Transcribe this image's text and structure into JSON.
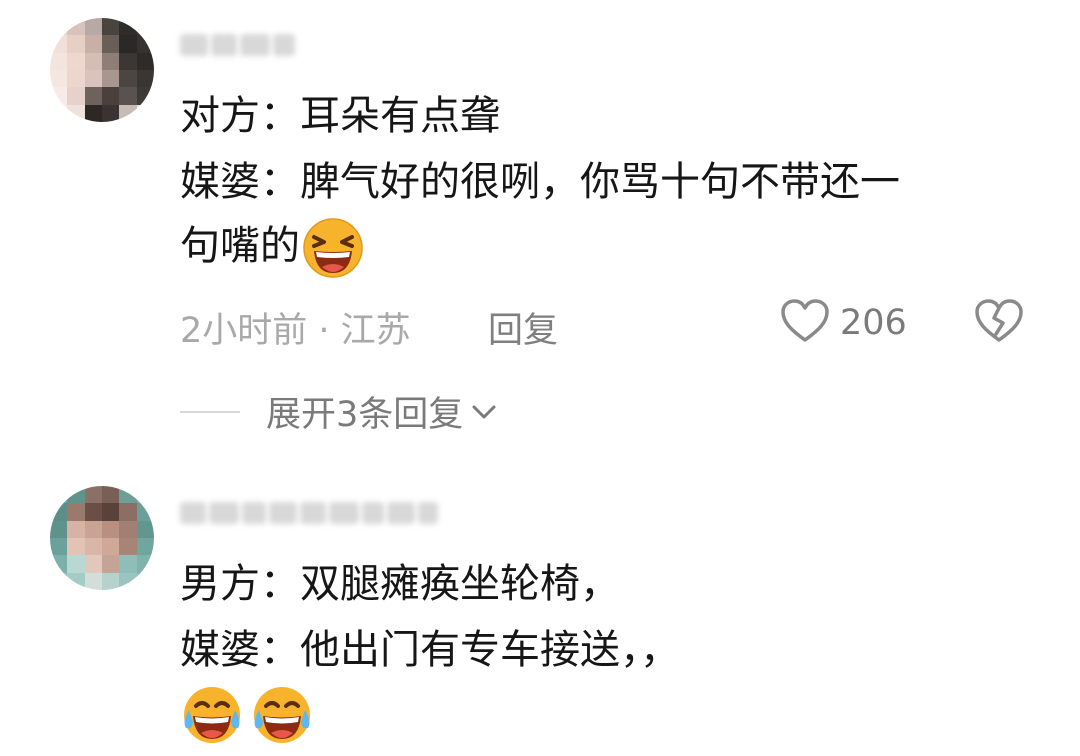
{
  "comments": [
    {
      "lines": [
        "对方：耳朵有点聋",
        "媒婆：脾气好的很咧，你骂十句不带还一",
        "句嘴的"
      ],
      "emoji_icon": "laughing-emoji",
      "time_location": "2小时前 · 江苏",
      "reply_label": "回复",
      "likes": "206",
      "expand_label": "展开3条回复"
    },
    {
      "lines": [
        "男方：双腿瘫痪坐轮椅，",
        "媒婆：他出门有专车接送，，"
      ],
      "emoji_icon": "tears-of-joy-emoji"
    }
  ],
  "colors": {
    "emoji_face": "#f7b32b",
    "emoji_mouth": "#8c2a12",
    "tear": "#5db8f0",
    "meta_text": "#a9a9a9",
    "action_text": "#7f7f7f"
  }
}
